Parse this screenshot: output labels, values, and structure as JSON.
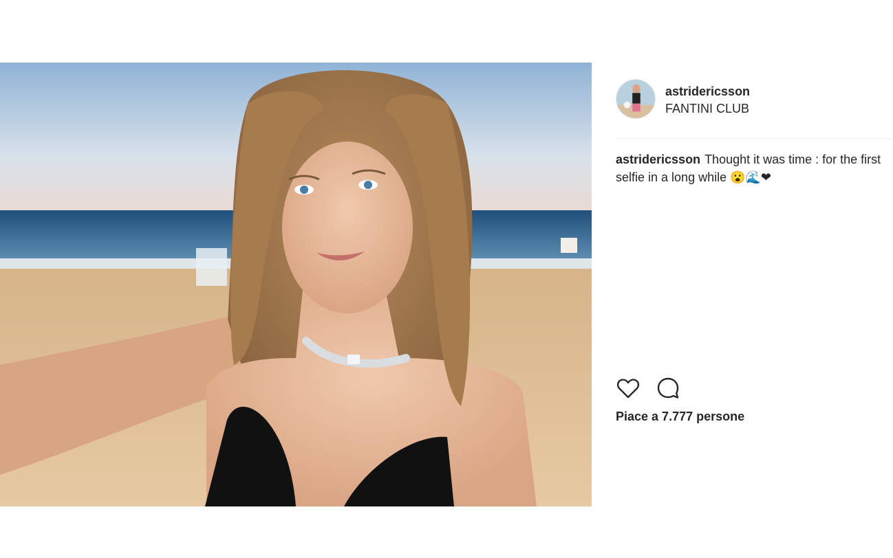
{
  "post": {
    "username": "astridericsson",
    "location": "FANTINI CLUB",
    "caption_user": "astridericsson",
    "caption_text": "Thought it was time : for the first selfie in a long while 😮🌊❤",
    "likes_text": "Piace a 7.777 persone"
  },
  "icons": {
    "like": "heart-icon",
    "comment": "comment-icon"
  },
  "colors": {
    "text": "#262626",
    "divider": "#efefef"
  }
}
